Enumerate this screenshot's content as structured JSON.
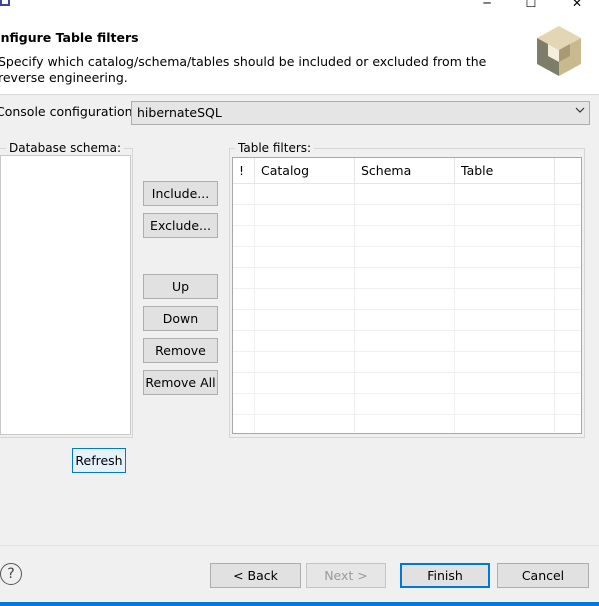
{
  "window": {
    "minimize_glyph": "─",
    "maximize_glyph": "☐",
    "close_glyph": "✕"
  },
  "header": {
    "title": "onfigure Table filters",
    "description": "Specify which catalog/schema/tables should be included or excluded from the reverse engineering."
  },
  "console": {
    "label": "Console configuration:",
    "value": "hibernateSQL"
  },
  "schema": {
    "label": "Database schema:",
    "refresh_label": "Refresh"
  },
  "actions": {
    "include_label": "Include...",
    "exclude_label": "Exclude...",
    "up_label": "Up",
    "down_label": "Down",
    "remove_label": "Remove",
    "remove_all_label": "Remove All"
  },
  "filters": {
    "label": "Table filters:",
    "columns": [
      "!",
      "Catalog",
      "Schema",
      "Table"
    ]
  },
  "footer": {
    "back_label": "< Back",
    "next_label": "Next >",
    "finish_label": "Finish",
    "cancel_label": "Cancel"
  },
  "colors": {
    "accent": "#0078d7",
    "logo_light": "#d9c9a3",
    "logo_dark": "#8a8a78"
  }
}
